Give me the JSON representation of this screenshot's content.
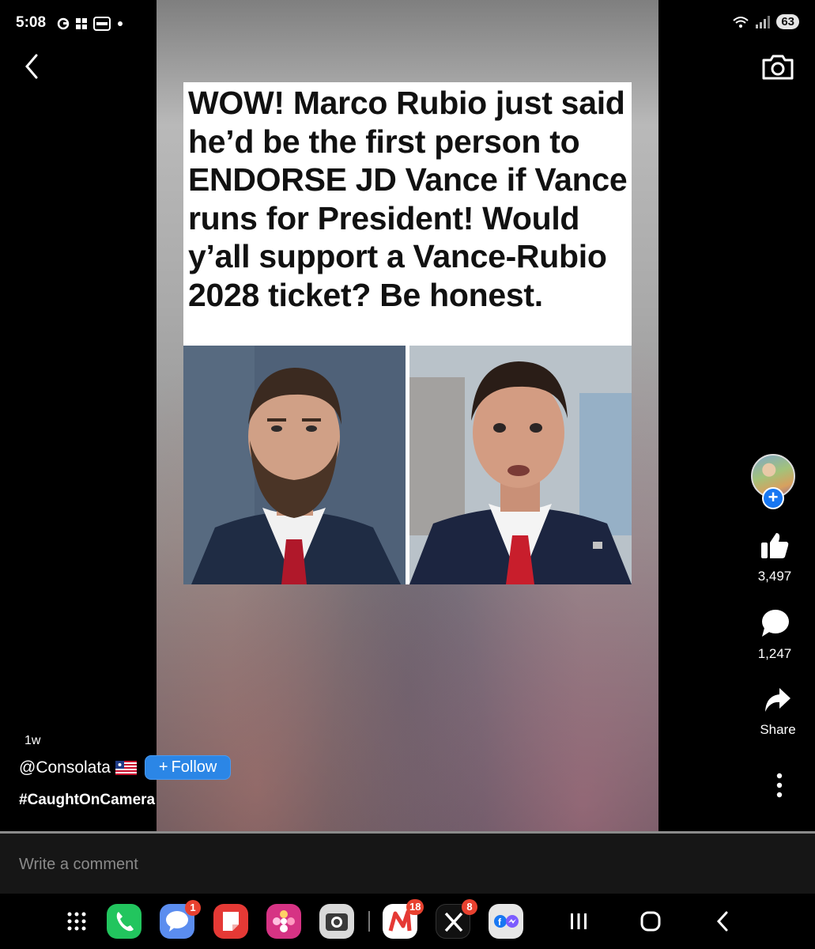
{
  "status_bar": {
    "time": "5:08",
    "left_icons": [
      "sync-icon",
      "grid-icon",
      "news-icon",
      "dot-icon"
    ],
    "battery": "63"
  },
  "post": {
    "headline": "WOW! Marco Rubio just said he’d be the first person to ENDORSE JD Vance if Vance runs for President! Would y’all support a Vance-Rubio 2028 ticket? Be honest."
  },
  "actions": {
    "likes": "3,497",
    "comments": "1,247",
    "share_label": "Share"
  },
  "caption": {
    "age": "1w",
    "author": "@Consolata",
    "follow_label": "Follow",
    "hashtag": "#CaughtOnCamera"
  },
  "comment_box": {
    "placeholder": "Write a comment"
  },
  "dock": {
    "apps": [
      {
        "name": "apps-grid"
      },
      {
        "name": "phone",
        "color": "#22c55e"
      },
      {
        "name": "messages",
        "color": "#5b8def",
        "badge": "1"
      },
      {
        "name": "notes",
        "color": "#e53935"
      },
      {
        "name": "gallery",
        "color": "#d63384"
      },
      {
        "name": "camera",
        "color": "#d9d9d9"
      },
      {
        "name": "news-app",
        "color": "#ffffff",
        "badge": "18"
      },
      {
        "name": "x-app",
        "color": "#111111",
        "badge": "8"
      },
      {
        "name": "facebook-messenger",
        "color": "#e6e6e6"
      }
    ]
  },
  "colors": {
    "follow_button": "#2b86e6",
    "avatar_plus": "#1877f2",
    "badge": "#e8412f"
  }
}
